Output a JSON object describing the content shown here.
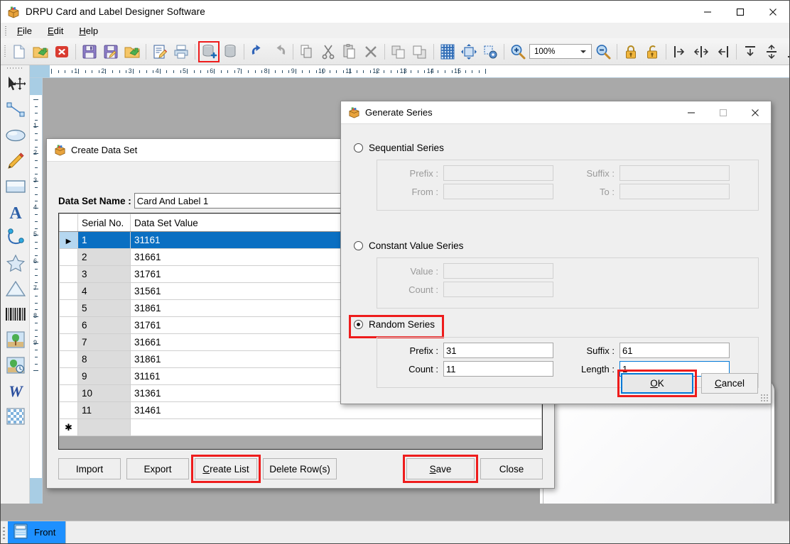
{
  "window": {
    "title": "DRPU Card and Label Designer Software",
    "app_icon": "package-icon",
    "minimize": "minimize-icon",
    "maximize": "maximize-icon",
    "close": "close-icon"
  },
  "menu": {
    "items": [
      {
        "label": "File",
        "mnemonic": "F"
      },
      {
        "label": "Edit",
        "mnemonic": "E"
      },
      {
        "label": "Help",
        "mnemonic": "H"
      }
    ]
  },
  "toolbar": {
    "zoom_value": "100%",
    "buttons": [
      {
        "name": "new-document-icon",
        "highlighted": false
      },
      {
        "name": "open-folder-icon",
        "highlighted": false
      },
      {
        "name": "close-document-icon",
        "highlighted": false
      },
      {
        "name": "save-icon",
        "highlighted": false
      },
      {
        "name": "save-as-icon",
        "highlighted": false
      },
      {
        "name": "open-recent-icon",
        "highlighted": false
      },
      {
        "name": "edit-document-icon",
        "highlighted": false
      },
      {
        "name": "print-icon",
        "highlighted": false
      },
      {
        "name": "create-data-set-icon",
        "highlighted": true
      },
      {
        "name": "data-set-icon",
        "highlighted": false
      },
      {
        "name": "undo-icon",
        "highlighted": false
      },
      {
        "name": "redo-icon",
        "highlighted": false
      },
      {
        "name": "copy-icon",
        "highlighted": false
      },
      {
        "name": "cut-icon",
        "highlighted": false
      },
      {
        "name": "paste-icon",
        "highlighted": false
      },
      {
        "name": "delete-icon",
        "highlighted": false
      },
      {
        "name": "bring-to-front-icon",
        "highlighted": false
      },
      {
        "name": "send-to-back-icon",
        "highlighted": false
      },
      {
        "name": "grid-icon",
        "highlighted": false
      },
      {
        "name": "resize-object-icon",
        "highlighted": false
      },
      {
        "name": "object-settings-icon",
        "highlighted": false
      },
      {
        "name": "zoom-in-icon",
        "highlighted": false
      },
      {
        "name": "zoom-out-icon",
        "highlighted": false
      },
      {
        "name": "lock-icon",
        "highlighted": false
      },
      {
        "name": "unlock-icon",
        "highlighted": false
      },
      {
        "name": "align-left-icon",
        "highlighted": false
      },
      {
        "name": "align-center-h-icon",
        "highlighted": false
      },
      {
        "name": "align-right-icon",
        "highlighted": false
      },
      {
        "name": "align-top-icon",
        "highlighted": false
      },
      {
        "name": "align-middle-v-icon",
        "highlighted": false
      },
      {
        "name": "align-bottom-icon",
        "highlighted": false
      },
      {
        "name": "currency-icon",
        "highlighted": false
      }
    ]
  },
  "tool_palette": {
    "tools": [
      {
        "name": "select-tool-icon"
      },
      {
        "name": "line-tool-icon"
      },
      {
        "name": "ellipse-tool-icon"
      },
      {
        "name": "pencil-tool-icon"
      },
      {
        "name": "rectangle-tool-icon"
      },
      {
        "name": "text-tool-icon"
      },
      {
        "name": "curve-tool-icon"
      },
      {
        "name": "star-tool-icon"
      },
      {
        "name": "triangle-tool-icon"
      },
      {
        "name": "barcode-tool-icon"
      },
      {
        "name": "image-tool-icon"
      },
      {
        "name": "watermark-tool-icon"
      },
      {
        "name": "signature-tool-icon"
      },
      {
        "name": "background-tool-icon"
      }
    ]
  },
  "rulers": {
    "horizontal_ticks": [
      "1",
      "2",
      "3",
      "4",
      "5",
      "6",
      "7",
      "8",
      "9",
      "10",
      "11",
      "12",
      "13",
      "14",
      "15"
    ],
    "vertical_ticks": [
      "1",
      "2",
      "3",
      "4",
      "5",
      "6",
      "7",
      "8",
      "9"
    ]
  },
  "page_tabs": {
    "tabs": [
      {
        "label": "Front",
        "icon": "card-front-icon",
        "active": true
      }
    ]
  },
  "create_data_set": {
    "title": "Create Data Set",
    "icon": "package-icon",
    "name_label": "Data Set Name :",
    "name_value": "Card And Label 1",
    "columns": [
      "",
      "Serial No.",
      "Data Set Value"
    ],
    "rows": [
      {
        "serial": "1",
        "value": "31161",
        "selected": true
      },
      {
        "serial": "2",
        "value": "31661",
        "selected": false
      },
      {
        "serial": "3",
        "value": "31761",
        "selected": false
      },
      {
        "serial": "4",
        "value": "31561",
        "selected": false
      },
      {
        "serial": "5",
        "value": "31861",
        "selected": false
      },
      {
        "serial": "6",
        "value": "31761",
        "selected": false
      },
      {
        "serial": "7",
        "value": "31661",
        "selected": false
      },
      {
        "serial": "8",
        "value": "31861",
        "selected": false
      },
      {
        "serial": "9",
        "value": "31161",
        "selected": false
      },
      {
        "serial": "10",
        "value": "31361",
        "selected": false
      },
      {
        "serial": "11",
        "value": "31461",
        "selected": false
      }
    ],
    "new_row_marker": "✱",
    "buttons": {
      "import": "Import",
      "export": "Export",
      "create_list": "Create List",
      "create_list_mnemonic": "C",
      "delete_rows": "Delete Row(s)",
      "save": "Save",
      "save_mnemonic": "S",
      "close": "Close"
    }
  },
  "generate_series": {
    "title": "Generate Series",
    "icon": "package-icon",
    "sections": [
      {
        "id": "sequential",
        "label": "Sequential Series",
        "selected": false,
        "enabled": false,
        "fields": [
          {
            "label": "Prefix :",
            "value": ""
          },
          {
            "label": "Suffix :",
            "value": ""
          },
          {
            "label": "From :",
            "value": ""
          },
          {
            "label": "To :",
            "value": ""
          }
        ]
      },
      {
        "id": "constant",
        "label": "Constant Value Series",
        "selected": false,
        "enabled": false,
        "fields": [
          {
            "label": "Value :",
            "value": ""
          },
          {
            "label": "Count :",
            "value": ""
          }
        ]
      },
      {
        "id": "random",
        "label": "Random Series",
        "selected": true,
        "enabled": true,
        "fields": [
          {
            "label": "Prefix :",
            "value": "31"
          },
          {
            "label": "Suffix :",
            "value": "61"
          },
          {
            "label": "Count :",
            "value": "11"
          },
          {
            "label": "Length :",
            "value": "1"
          }
        ]
      }
    ],
    "ok_label": "OK",
    "ok_mnemonic": "O",
    "cancel_label": "Cancel",
    "cancel_mnemonic": "C"
  },
  "colors": {
    "highlight_red": "#ee1c1c",
    "selection_blue": "#0a6fc2",
    "focus_blue": "#0078d7",
    "tab_blue": "#1e90ff",
    "canvas_gray": "#a9a9a9"
  }
}
